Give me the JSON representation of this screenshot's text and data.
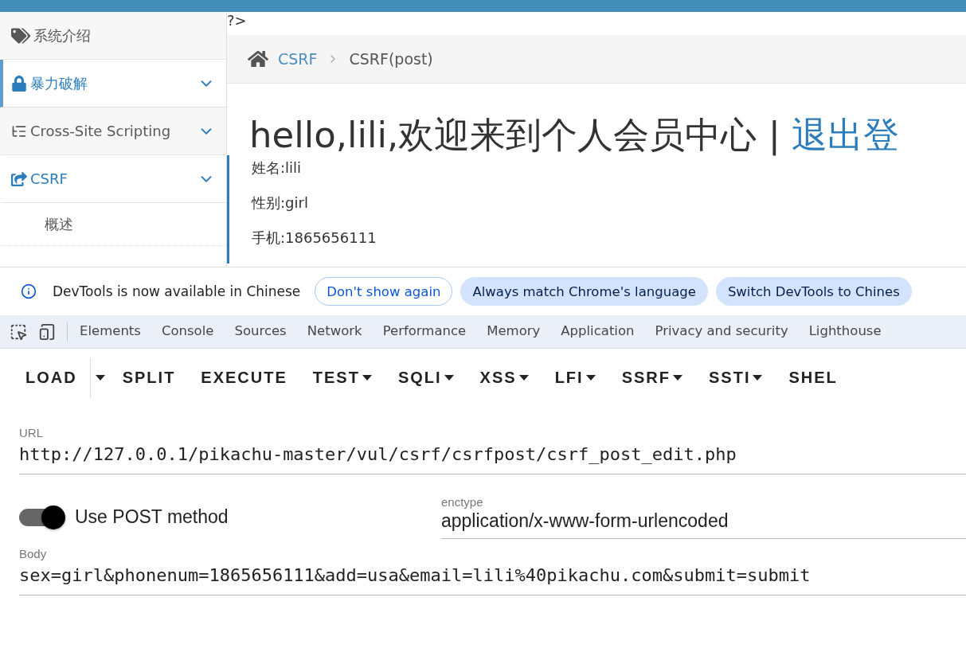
{
  "sidebar": {
    "items": [
      {
        "label": "系统介绍",
        "selected": false,
        "highlighted": false,
        "chevron": false
      },
      {
        "label": "暴力破解",
        "selected": true,
        "highlighted": true,
        "chevron": true
      },
      {
        "label": "Cross-Site Scripting",
        "selected": false,
        "highlighted": false,
        "chevron": true
      },
      {
        "label": "CSRF",
        "selected": false,
        "highlighted": true,
        "chevron": true,
        "children": [
          {
            "label": "概述"
          }
        ]
      }
    ]
  },
  "page": {
    "stray_text": "?>",
    "breadcrumb": [
      {
        "label": "CSRF",
        "link": true
      },
      {
        "label": "CSRF(post)",
        "link": false
      }
    ],
    "heading": "hello,lili,欢迎来到个人会员中心 | ",
    "logout_link": "退出登",
    "info": [
      "姓名:lili",
      "性别:girl",
      "手机:1865656111"
    ]
  },
  "devtools": {
    "infobar": {
      "message": "DevTools is now available in Chinese",
      "buttons": [
        {
          "label": "Don't show again",
          "kind": "outline"
        },
        {
          "label": "Always match Chrome's language",
          "kind": "filled"
        },
        {
          "label": "Switch DevTools to Chines",
          "kind": "filled"
        }
      ]
    },
    "tabs": [
      {
        "label": "Elements",
        "selected": false
      },
      {
        "label": "Console",
        "selected": false
      },
      {
        "label": "Sources",
        "selected": false
      },
      {
        "label": "Network",
        "selected": false
      },
      {
        "label": "Performance",
        "selected": false
      },
      {
        "label": "Memory",
        "selected": false
      },
      {
        "label": "Application",
        "selected": false
      },
      {
        "label": "Privacy and security",
        "selected": false
      },
      {
        "label": "Lighthouse",
        "selected": false
      }
    ]
  },
  "hackbar": {
    "toolbar": [
      {
        "label": "LOAD",
        "kind": "split"
      },
      {
        "label": "SPLIT",
        "kind": "button"
      },
      {
        "label": "EXECUTE",
        "kind": "button"
      },
      {
        "label": "TEST",
        "kind": "dropdown"
      },
      {
        "label": "SQLI",
        "kind": "dropdown"
      },
      {
        "label": "XSS",
        "kind": "dropdown"
      },
      {
        "label": "LFI",
        "kind": "dropdown"
      },
      {
        "label": "SSRF",
        "kind": "dropdown"
      },
      {
        "label": "SSTI",
        "kind": "dropdown"
      },
      {
        "label": "SHEL",
        "kind": "button"
      }
    ],
    "url": {
      "label": "URL",
      "value": "http://127.0.0.1/pikachu-master/vul/csrf/csrfpost/csrf_post_edit.php"
    },
    "post_toggle": {
      "label": "Use POST method",
      "on": true
    },
    "enctype": {
      "label": "enctype",
      "value": "application/x-www-form-urlencoded"
    },
    "body": {
      "label": "Body",
      "value": "sex=girl&phonenum=1865656111&add=usa&email=lili%40pikachu.com&submit=submit"
    }
  }
}
